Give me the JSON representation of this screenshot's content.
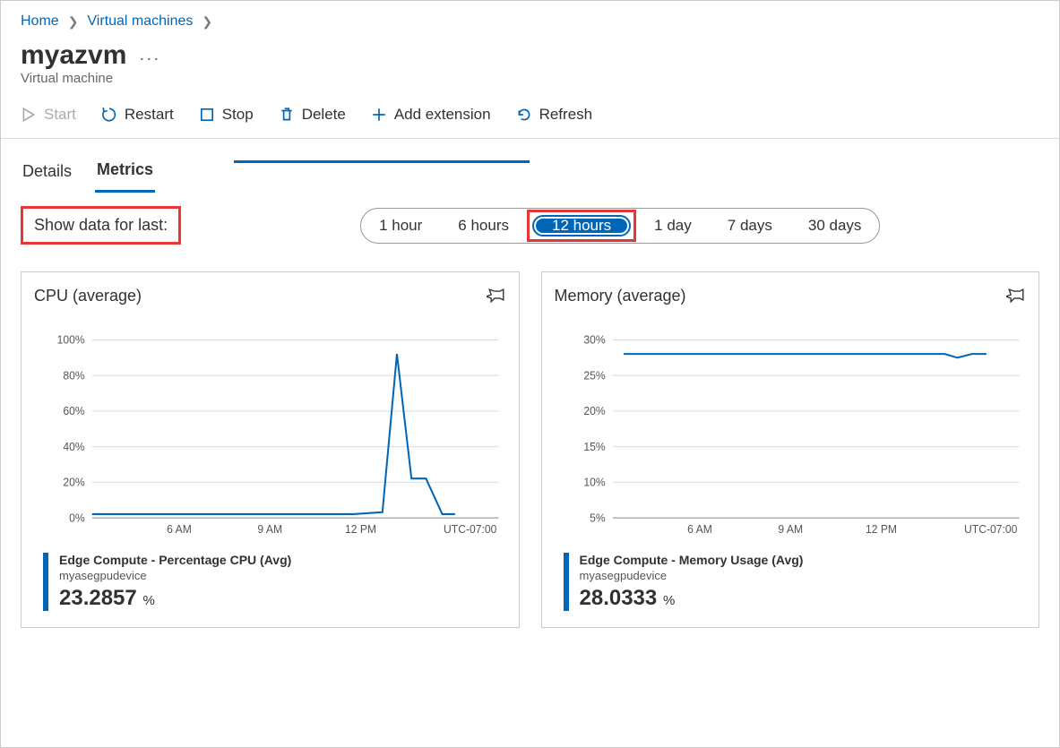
{
  "breadcrumb": {
    "home": "Home",
    "vms": "Virtual machines"
  },
  "title": "myazvm",
  "subtitle": "Virtual machine",
  "toolbar": {
    "start": "Start",
    "restart": "Restart",
    "stop": "Stop",
    "delete": "Delete",
    "add_extension": "Add extension",
    "refresh": "Refresh"
  },
  "tabs": {
    "details": "Details",
    "metrics": "Metrics"
  },
  "timerange": {
    "label": "Show data for last:",
    "options": [
      "1 hour",
      "6 hours",
      "12 hours",
      "1 day",
      "7 days",
      "30 days"
    ],
    "selected": "12 hours"
  },
  "cards": {
    "cpu": {
      "title": "CPU (average)",
      "summary_label": "Edge Compute - Percentage CPU (Avg)",
      "device": "myasegpudevice",
      "value": "23.2857",
      "unit": "%"
    },
    "memory": {
      "title": "Memory (average)",
      "summary_label": "Edge Compute - Memory Usage (Avg)",
      "device": "myasegpudevice",
      "value": "28.0333",
      "unit": "%"
    }
  },
  "chart_data": [
    {
      "type": "line",
      "title": "CPU (average)",
      "xlabel": "",
      "ylabel": "",
      "ylim": [
        0,
        100
      ],
      "y_ticks": [
        "0%",
        "20%",
        "40%",
        "60%",
        "80%",
        "100%"
      ],
      "x_ticks": [
        "6 AM",
        "9 AM",
        "12 PM",
        "UTC-07:00"
      ],
      "x": [
        "3 AM",
        "4 AM",
        "5 AM",
        "6 AM",
        "7 AM",
        "8 AM",
        "9 AM",
        "10 AM",
        "11 AM",
        "12 PM",
        "1 PM",
        "1:30 PM",
        "2 PM",
        "2:30 PM",
        "3 PM"
      ],
      "series": [
        {
          "name": "Percentage CPU (Avg)",
          "values": [
            2,
            2,
            2,
            2,
            2,
            2,
            2,
            2,
            2,
            2,
            3,
            92,
            22,
            22,
            2
          ]
        }
      ]
    },
    {
      "type": "line",
      "title": "Memory (average)",
      "xlabel": "",
      "ylabel": "",
      "ylim": [
        0,
        30
      ],
      "y_ticks": [
        "5%",
        "10%",
        "15%",
        "20%",
        "25%",
        "30%"
      ],
      "x_ticks": [
        "6 AM",
        "9 AM",
        "12 PM",
        "UTC-07:00"
      ],
      "x": [
        "3 AM",
        "4 AM",
        "5 AM",
        "6 AM",
        "7 AM",
        "8 AM",
        "9 AM",
        "10 AM",
        "11 AM",
        "12 PM",
        "1 PM",
        "2 PM",
        "2:30 PM",
        "3 PM"
      ],
      "series": [
        {
          "name": "Memory Usage (Avg)",
          "values": [
            28,
            28,
            28,
            28,
            28,
            28,
            28,
            28,
            28,
            28,
            28,
            28,
            27.5,
            28
          ]
        }
      ]
    }
  ]
}
